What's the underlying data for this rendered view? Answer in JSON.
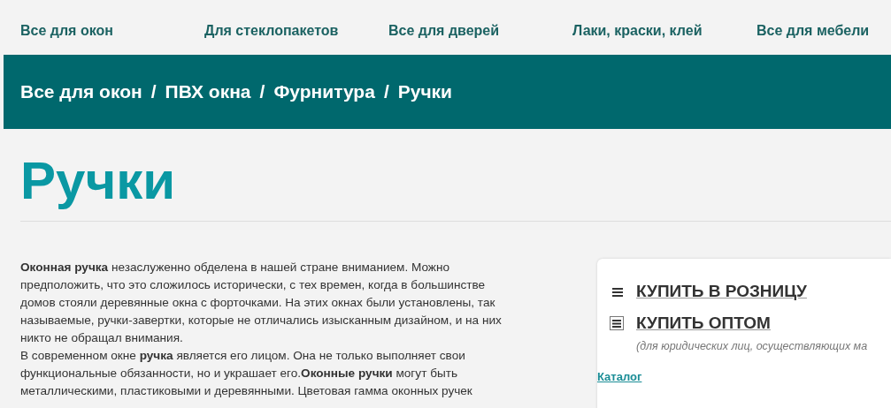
{
  "nav": [
    "Все для окон",
    "Для стеклопакетов",
    "Все для дверей",
    "Лаки, краски, клей",
    "Все для мебели"
  ],
  "breadcrumb": {
    "separator": "/",
    "items": [
      "Все для окон",
      "ПВХ окна",
      "Фурнитура",
      "Ручки"
    ]
  },
  "title": "Ручки",
  "paragraphs": [
    "**Оконная ручка** незаслуженно обделена в нашей стране вниманием. Можно предположить, что это сложилось исторически, с тех времен, когда в большинстве домов стояли деревянные окна с форточками. На этих окнах были установлены, так называемые, ручки-завертки, которые не отличались изысканным дизайном, и на них никто не обращал внимания.",
    "В современном окне **ручка** является его лицом. Она не только выполняет свои функциональные обязанности, но и украшает его.**Оконные ручки** могут быть металлическими, пластиковыми и деревянными. Цветовая гамма оконных ручек"
  ],
  "buy_options": [
    {
      "kind": "plain",
      "label": "КУПИТЬ В РОЗНИЦУ"
    },
    {
      "kind": "boxed",
      "label": "КУПИТЬ ОПТОМ",
      "note": "(для юридических лиц, осуществляющих ма"
    }
  ],
  "catalog_link": "Каталог"
}
